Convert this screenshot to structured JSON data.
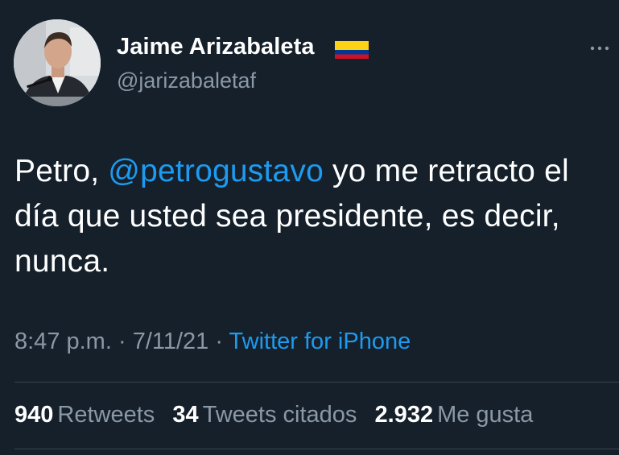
{
  "author": {
    "display_name": "Jaime Arizabaleta",
    "handle": "@jarizabaletaf",
    "flag_icon": "colombia-flag-icon",
    "avatar_icon": "profile-photo"
  },
  "tweet": {
    "text_before": "Petro, ",
    "mention": "@petrogustavo",
    "text_after": " yo me retracto el día que usted sea presidente, es decir, nunca."
  },
  "meta": {
    "time": "8:47 p.m.",
    "separator1": " · ",
    "date": "7/11/21",
    "separator2": " · ",
    "source": "Twitter for iPhone"
  },
  "stats": {
    "retweets_count": "940",
    "retweets_label": "Retweets",
    "quotes_count": "34",
    "quotes_label": "Tweets citados",
    "likes_count": "2.932",
    "likes_label": "Me gusta"
  },
  "colors": {
    "background": "#15202b",
    "text": "#ffffff",
    "secondary": "#8b98a5",
    "link": "#1d9bf0",
    "divider": "#38444d",
    "flag_yellow": "#fcd116",
    "flag_blue": "#003893",
    "flag_red": "#ce1126"
  }
}
